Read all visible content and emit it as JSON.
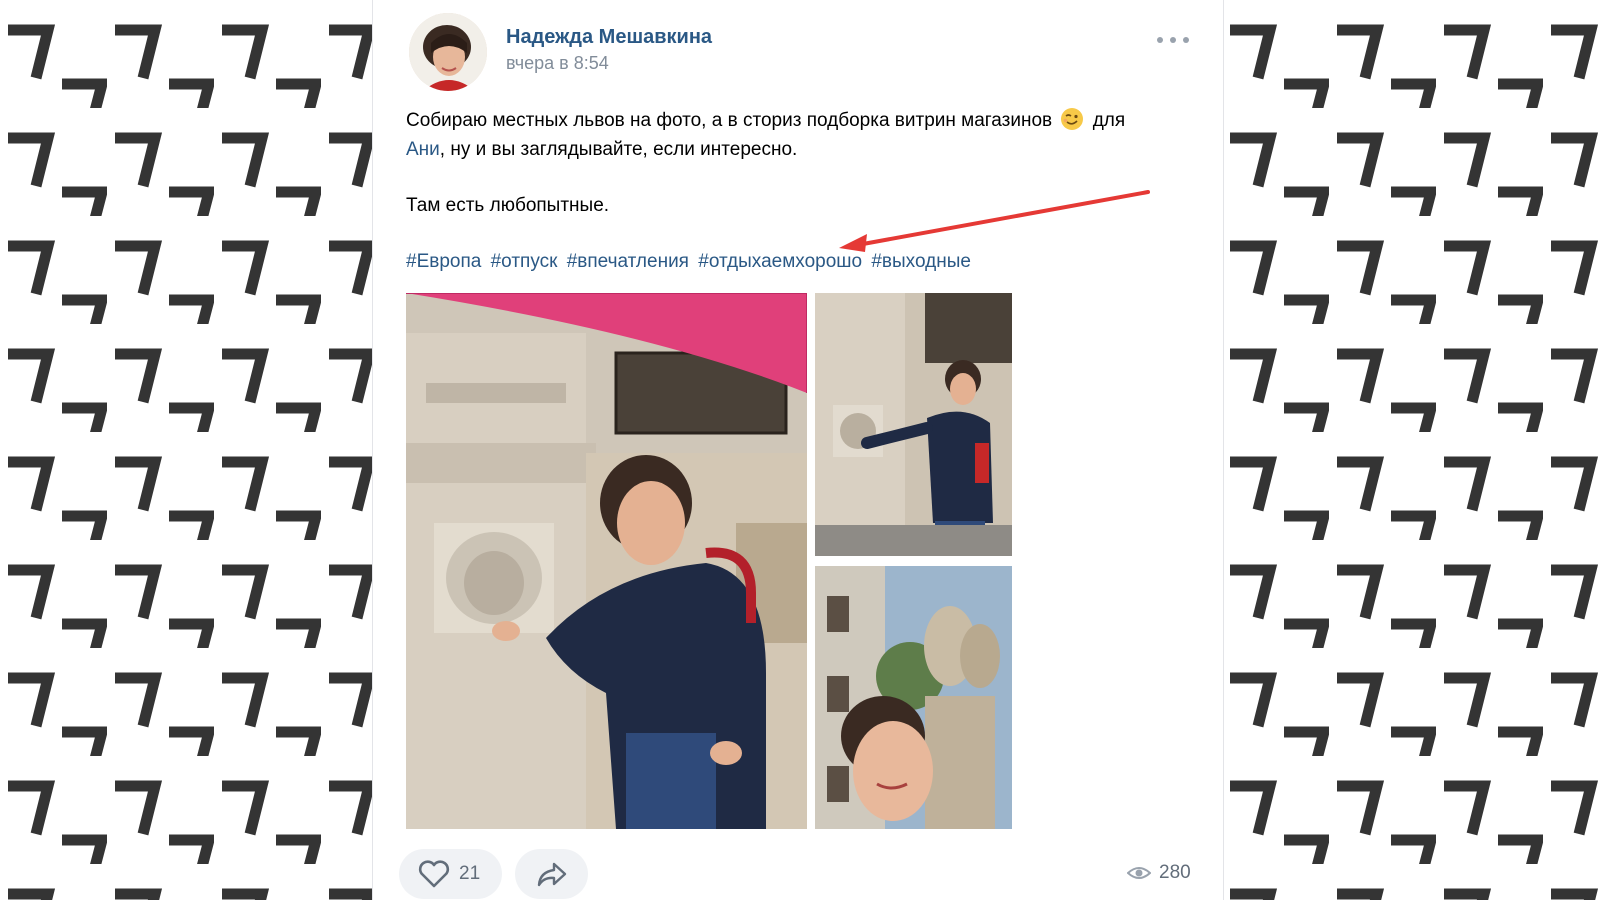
{
  "post": {
    "author": "Надежда Мешавкина",
    "timestamp": "вчера в 8:54",
    "text_line1": "Собираю местных львов на фото, а в сториз подборка витрин магазинов",
    "text_after_emoji": "для",
    "mention": "Ани",
    "text_line2": ", ну и вы заглядывайте, если интересно.",
    "text_para2": "Там есть любопытные.",
    "emoji": "winking-face-icon",
    "hashtags": [
      "#Европа",
      "#отпуск",
      "#впечатления",
      "#отдыхаемхорошо",
      "#выходные"
    ],
    "photos": [
      {
        "name": "photo-woman-with-lion-relief"
      },
      {
        "name": "photo-woman-pointing-at-lion"
      },
      {
        "name": "photo-selfie-with-lion-statue"
      }
    ]
  },
  "footer": {
    "like_count": "21",
    "views_count": "280",
    "like_icon": "heart-icon",
    "share_icon": "share-arrow-icon",
    "views_icon": "eye-icon"
  },
  "colors": {
    "link": "#2a5885",
    "muted": "#818c99",
    "annotation_arrow": "#e53935",
    "umbrella": "#e0407a"
  }
}
